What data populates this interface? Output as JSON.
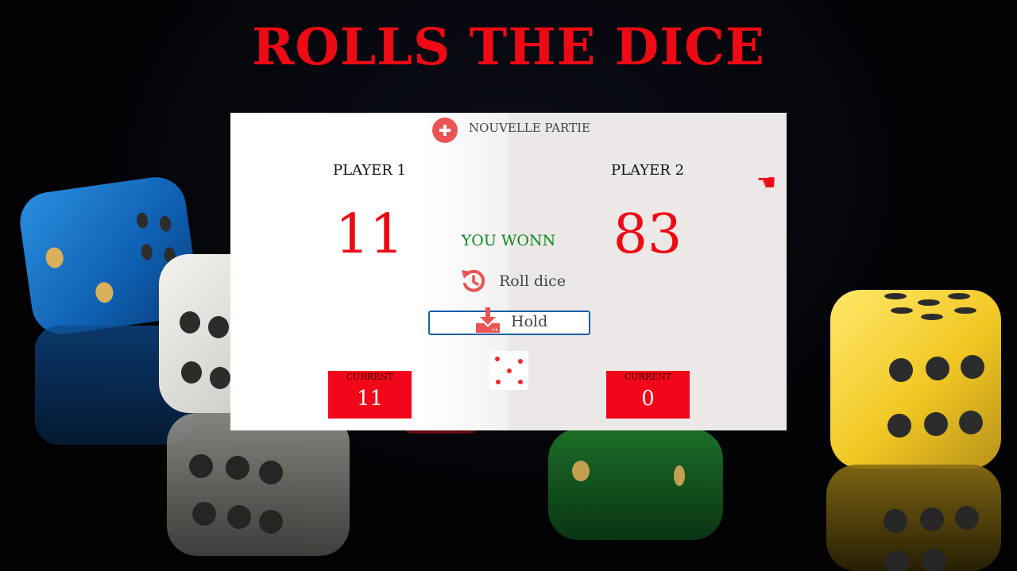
{
  "title": "ROLLS THE DICE",
  "new_game_label": "NOUVELLE PARTIE",
  "players": [
    {
      "name": "PLAYER 1",
      "global_score": "11",
      "current_label": "CURRENT",
      "current_score": "11"
    },
    {
      "name": "PLAYER 2",
      "global_score": "83",
      "current_label": "CURRENT",
      "current_score": "0"
    }
  ],
  "active_player": 2,
  "win_message": "YOU WONN",
  "roll_label": "Roll dice",
  "hold_label": "Hold",
  "dice_value": 5,
  "colors": {
    "accent_red": "#ee0a14",
    "win_green": "#0a8a1e",
    "icon_red": "#ea5455",
    "hold_border": "#1a5fa8"
  },
  "icons": {
    "new_game": "plus-circle-icon",
    "roll": "rotate-left-icon",
    "hold": "download-icon",
    "turn": "pointing-hand-icon"
  }
}
